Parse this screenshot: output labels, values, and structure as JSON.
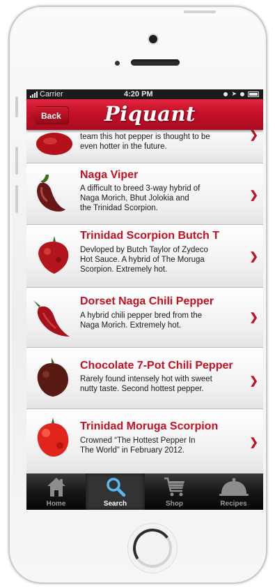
{
  "status_bar": {
    "carrier": "Carrier",
    "time": "4:20 PM"
  },
  "nav": {
    "back_label": "Back",
    "title": "Piquant"
  },
  "peppers": [
    {
      "name": "",
      "description": [
        "team this hot pepper is thought to be",
        "even hotter in the future."
      ]
    },
    {
      "name": "Naga Viper",
      "description": [
        "A difficult to breed 3-way hybrid of",
        "Naga Morich, Bhut Jolokia and",
        "the Trinidad Scorpion."
      ]
    },
    {
      "name": "Trinidad Scorpion Butch T",
      "description": [
        "Devloped by Butch Taylor of Zydeco",
        "Hot Sauce. A hybrid of The Moruga",
        "Scorpion. Extremely hot."
      ]
    },
    {
      "name": "Dorset Naga Chili Pepper",
      "description": [
        "A hybrid chili pepper bred from the",
        "Naga Morich. Extremely hot."
      ]
    },
    {
      "name": "Chocolate 7-Pot Chili Pepper",
      "description": [
        "Rarely found intensely hot with sweet",
        "nutty taste. Second hottest pepper."
      ]
    },
    {
      "name": "Trinidad Moruga Scorpion",
      "description": [
        "Crowned “The Hottest Pepper In",
        "The World” in February 2012."
      ]
    }
  ],
  "tabs": [
    {
      "label": "Home",
      "icon": "house-icon"
    },
    {
      "label": "Search",
      "icon": "magnifier-icon",
      "active": true
    },
    {
      "label": "Shop",
      "icon": "cart-icon"
    },
    {
      "label": "Recipes",
      "icon": "cloche-icon"
    }
  ],
  "colors": {
    "accent": "#c41023",
    "nav_bar": "#c4102a",
    "tab_bar": "#111111"
  }
}
